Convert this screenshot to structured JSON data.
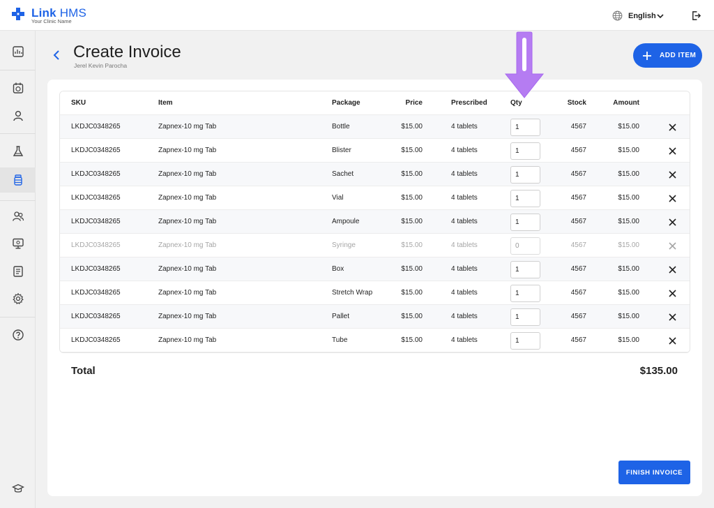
{
  "app": {
    "brand_bold": "Link",
    "brand_light": "HMS",
    "brand_sub": "Your Clinic Name",
    "language": "English",
    "accent_color": "#1e63e6"
  },
  "icons": {
    "logo": "medical-cross-icon",
    "language": "globe-icon",
    "chevron": "chevron-down-icon",
    "logout": "logout-icon",
    "back": "chevron-left-icon",
    "add": "plus-icon",
    "remove": "close-icon",
    "annotation": "arrow-down-icon"
  },
  "sidebar": {
    "items": [
      {
        "name": "dashboard-icon"
      },
      {
        "name": "appointments-icon"
      },
      {
        "name": "patients-icon"
      },
      {
        "name": "lab-icon"
      },
      {
        "name": "pharmacy-icon",
        "active": true
      },
      {
        "name": "staff-icon"
      },
      {
        "name": "monitor-icon"
      },
      {
        "name": "reports-icon"
      },
      {
        "name": "settings-icon"
      },
      {
        "name": "help-icon"
      },
      {
        "name": "education-icon"
      }
    ]
  },
  "header": {
    "title": "Create Invoice",
    "subtitle": "Jerel Kevin Parocha",
    "add_item_label": "ADD ITEM"
  },
  "table": {
    "columns": {
      "sku": "SKU",
      "item": "Item",
      "package": "Package",
      "price": "Price",
      "prescribed": "Prescribed",
      "qty": "Qty",
      "stock": "Stock",
      "amount": "Amount"
    },
    "rows": [
      {
        "sku": "LKDJC0348265",
        "item": "Zapnex-10 mg Tab",
        "package": "Bottle",
        "price": "$15.00",
        "prescribed": "4 tablets",
        "qty": "1",
        "stock": "4567",
        "amount": "$15.00",
        "disabled": false
      },
      {
        "sku": "LKDJC0348265",
        "item": "Zapnex-10 mg Tab",
        "package": "Blister",
        "price": "$15.00",
        "prescribed": "4 tablets",
        "qty": "1",
        "stock": "4567",
        "amount": "$15.00",
        "disabled": false
      },
      {
        "sku": "LKDJC0348265",
        "item": "Zapnex-10 mg Tab",
        "package": "Sachet",
        "price": "$15.00",
        "prescribed": "4 tablets",
        "qty": "1",
        "stock": "4567",
        "amount": "$15.00",
        "disabled": false
      },
      {
        "sku": "LKDJC0348265",
        "item": "Zapnex-10 mg Tab",
        "package": "Vial",
        "price": "$15.00",
        "prescribed": "4 tablets",
        "qty": "1",
        "stock": "4567",
        "amount": "$15.00",
        "disabled": false
      },
      {
        "sku": "LKDJC0348265",
        "item": "Zapnex-10 mg Tab",
        "package": "Ampoule",
        "price": "$15.00",
        "prescribed": "4 tablets",
        "qty": "1",
        "stock": "4567",
        "amount": "$15.00",
        "disabled": false
      },
      {
        "sku": "LKDJC0348265",
        "item": "Zapnex-10 mg Tab",
        "package": "Syringe",
        "price": "$15.00",
        "prescribed": "4 tablets",
        "qty": "0",
        "stock": "4567",
        "amount": "$15.00",
        "disabled": true
      },
      {
        "sku": "LKDJC0348265",
        "item": "Zapnex-10 mg Tab",
        "package": "Box",
        "price": "$15.00",
        "prescribed": "4 tablets",
        "qty": "1",
        "stock": "4567",
        "amount": "$15.00",
        "disabled": false
      },
      {
        "sku": "LKDJC0348265",
        "item": "Zapnex-10 mg Tab",
        "package": "Stretch Wrap",
        "price": "$15.00",
        "prescribed": "4 tablets",
        "qty": "1",
        "stock": "4567",
        "amount": "$15.00",
        "disabled": false
      },
      {
        "sku": "LKDJC0348265",
        "item": "Zapnex-10 mg Tab",
        "package": "Pallet",
        "price": "$15.00",
        "prescribed": "4 tablets",
        "qty": "1",
        "stock": "4567",
        "amount": "$15.00",
        "disabled": false
      },
      {
        "sku": "LKDJC0348265",
        "item": "Zapnex-10 mg Tab",
        "package": "Tube",
        "price": "$15.00",
        "prescribed": "4 tablets",
        "qty": "1",
        "stock": "4567",
        "amount": "$15.00",
        "disabled": false
      }
    ]
  },
  "summary": {
    "total_label": "Total",
    "total_value": "$135.00"
  },
  "footer": {
    "finish_label": "FINISH INVOICE"
  }
}
